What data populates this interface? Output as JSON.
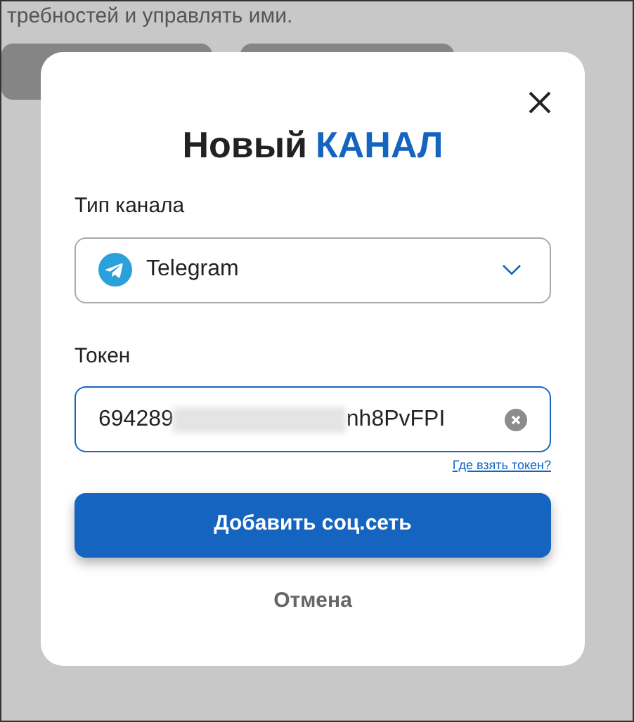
{
  "background_page": {
    "text": "требностей и управлять ими.",
    "buttons": [
      {
        "kind": "dimmed"
      },
      {
        "kind": "dimmed"
      }
    ]
  },
  "dialog": {
    "title_start": "Новый",
    "title_accent": "КАНАЛ",
    "channel_type": {
      "label": "Тип канала",
      "value": "Telegram"
    },
    "token": {
      "label": "Токен",
      "value_start": "694289",
      "value_end": "nh8PvFPI",
      "help_link": "Где взять токен?"
    },
    "submit": "Добавить соц.сеть",
    "cancel": "Отмена"
  }
}
